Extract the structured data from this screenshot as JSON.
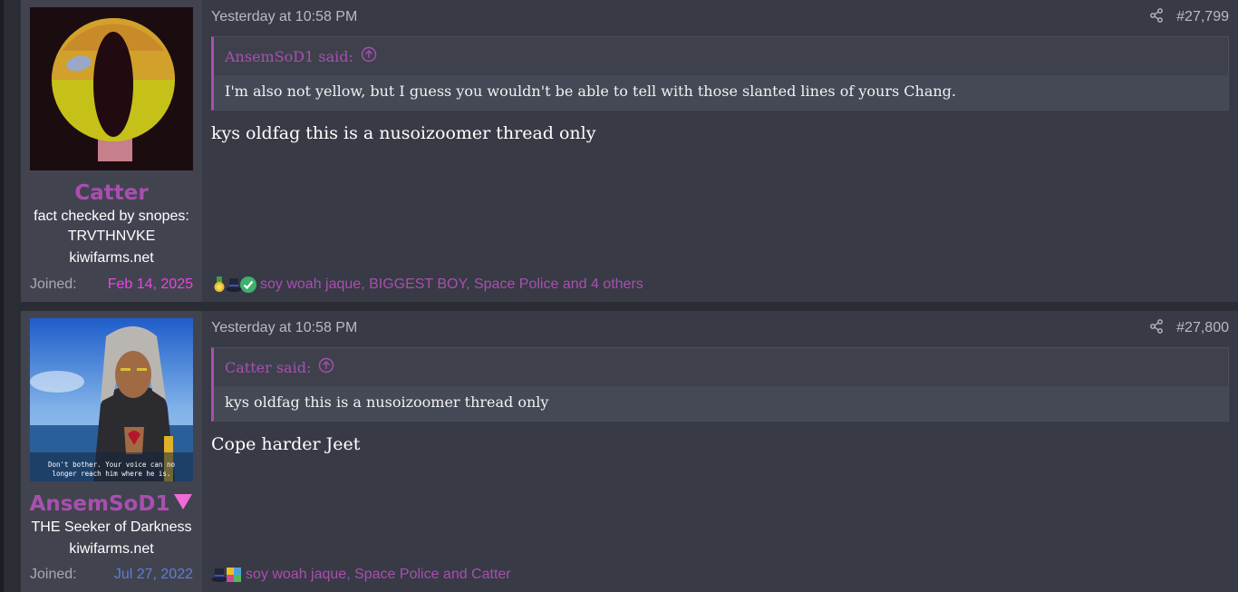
{
  "posts": [
    {
      "username": "Catter",
      "user_title": "fact checked by snopes: TRVTHNVKE",
      "banner": "kiwifarms.net",
      "joined_label": "Joined:",
      "joined_date": "Feb 14, 2025",
      "joined_color": "#e846e0",
      "timestamp": "Yesterday at 10:58 PM",
      "post_number": "#27,799",
      "quote": {
        "author": "AnsemSoD1 said:",
        "text": "I'm also not yellow, but I guess you wouldn't be able to tell with those slanted lines of yours Chang."
      },
      "message": "kys oldfag this is a nusoizoomer thread only",
      "reactions": {
        "icons": [
          "medal-icon",
          "top-hat-icon",
          "checkmark-icon"
        ],
        "text": "soy woah jaque, BIGGEST BOY, Space Police and 4 others"
      }
    },
    {
      "username": "AnsemSoD1",
      "user_title": "THE Seeker of Darkness",
      "banner": "kiwifarms.net",
      "joined_label": "Joined:",
      "joined_date": "Jul 27, 2022",
      "joined_color": "#5f7ed8",
      "timestamp": "Yesterday at 10:58 PM",
      "post_number": "#27,800",
      "avatar_caption": "Don't bother. Your voice can no longer reach him where he is.",
      "quote": {
        "author": "Catter said:",
        "text": "kys oldfag this is a nusoizoomer thread only"
      },
      "message": "Cope harder Jeet",
      "reactions": {
        "icons": [
          "top-hat-icon",
          "puzzle-icon"
        ],
        "text": "soy woah jaque, Space Police and Catter"
      }
    }
  ],
  "colors": {
    "accent": "#a94fb0",
    "post_bg": "#383a45",
    "user_bg": "#41444f"
  }
}
